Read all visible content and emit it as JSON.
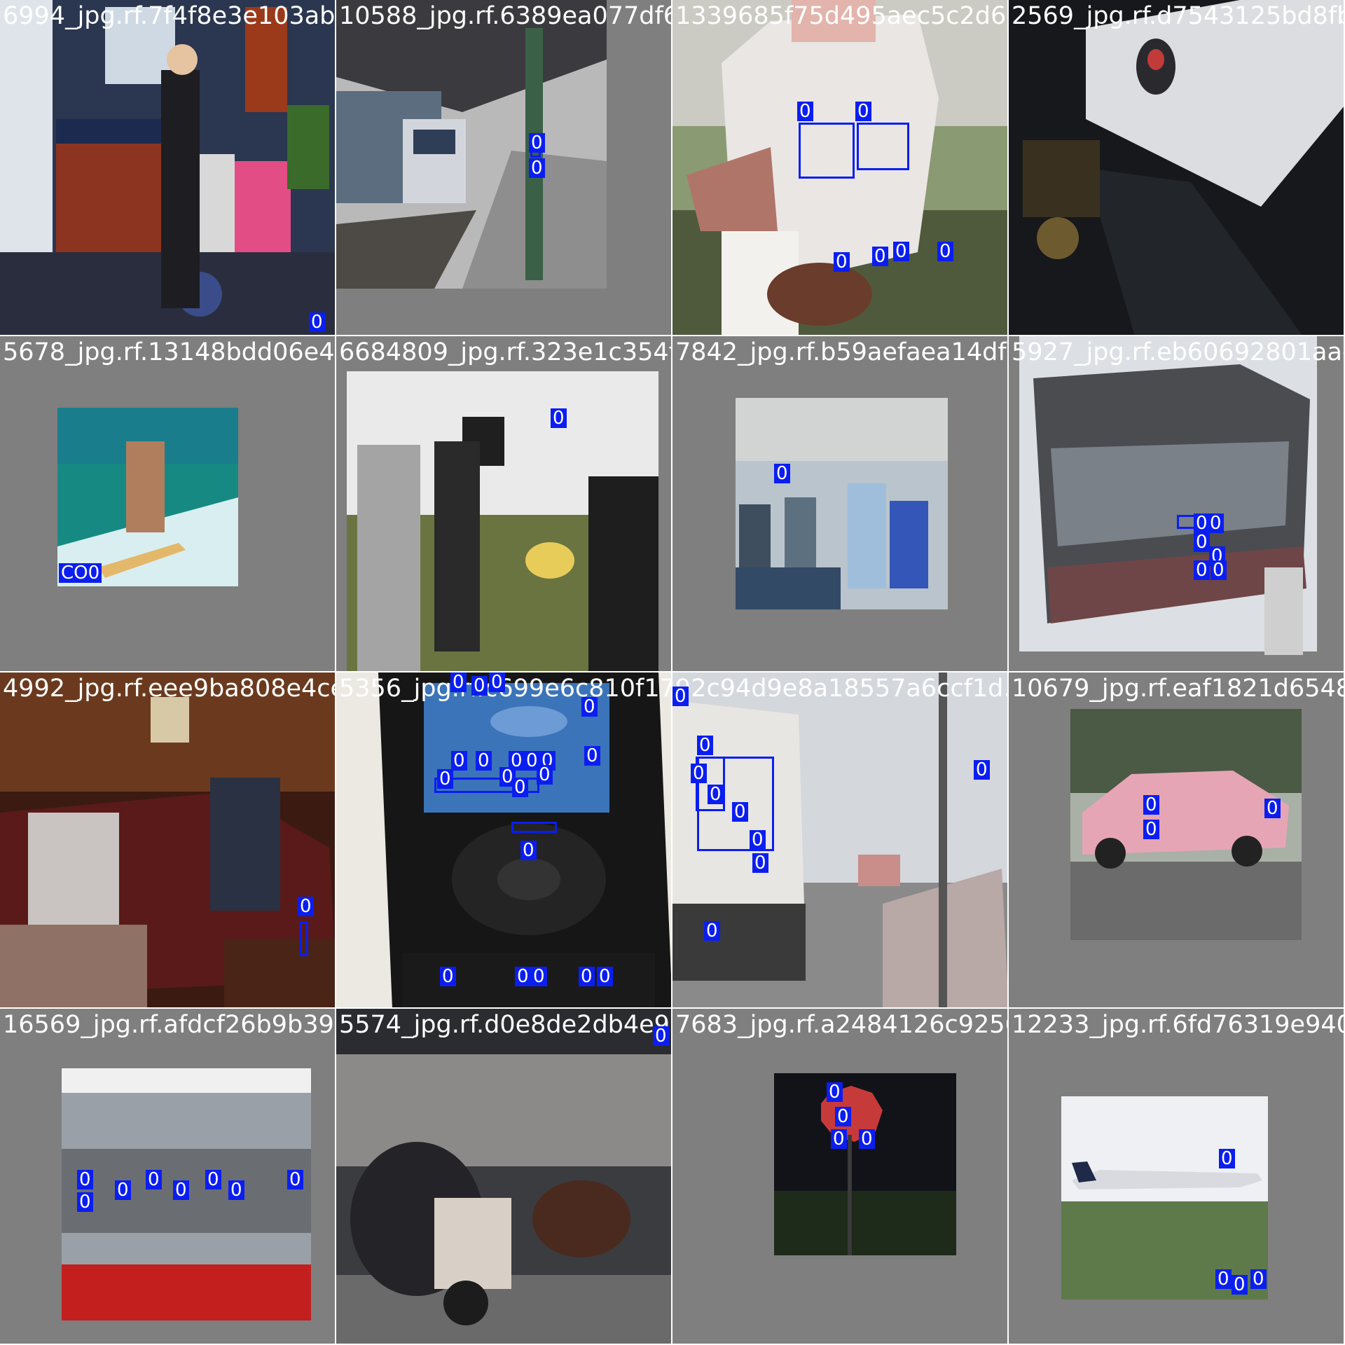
{
  "mosaic": {
    "label_color": "#0b1ef0",
    "tiles": [
      {
        "filename": "6994_jpg.rf.7f4f8e3e103ab8f06588df63...",
        "scene": "kitchen with woman",
        "labels": [
          "0"
        ]
      },
      {
        "filename": "10588_jpg.rf.6389ea077df69098234b3...",
        "scene": "train station platform",
        "labels": [
          "0",
          "0"
        ]
      },
      {
        "filename": "1339685f75d495aec5c2d6258d96ef76...",
        "scene": "baseball player",
        "labels": [
          "0",
          "0",
          "0",
          "0",
          "0",
          "0"
        ]
      },
      {
        "filename": "2569_jpg.rf.d7543125bd8fbb37...",
        "scene": "desk with keyboard and mouse",
        "labels": []
      },
      {
        "filename": "5678_jpg.rf.13148bdd06e46d064800f5288af...",
        "scene": "surfer on wave",
        "labels": [
          "CO0"
        ]
      },
      {
        "filename": "6684809_jpg.rf.323e1c354fa4b8da...",
        "scene": "men playing frisbee",
        "labels": [
          "0"
        ]
      },
      {
        "filename": "7842_jpg.rf.b59aefaea14df0bf30...",
        "scene": "office party",
        "labels": [
          "0"
        ]
      },
      {
        "filename": "5927_jpg.rf.eb60692801aad48...",
        "scene": "tour bus",
        "labels": [
          "0",
          "0",
          "0",
          "0",
          "0",
          "0"
        ]
      },
      {
        "filename": "4992_jpg.rf.eee9ba808e4ce...",
        "scene": "living room with people on couch",
        "labels": [
          "0"
        ]
      },
      {
        "filename": "5356_jpg.rf.c699e6c810f17ab58...",
        "scene": "cell phone close-up",
        "labels": [
          "0",
          "0",
          "0",
          "0",
          "0",
          "0",
          "0",
          "0",
          "0",
          "0",
          "0",
          "0",
          "0",
          "0",
          "0",
          "0",
          "0",
          "0",
          "0",
          "0"
        ]
      },
      {
        "filename": "92c94d9e8a18557a6ccf1d...",
        "scene": "truck in traffic",
        "labels": [
          "0",
          "0",
          "0",
          "0",
          "0",
          "0",
          "0",
          "0",
          "0"
        ]
      },
      {
        "filename": "10679_jpg.rf.eaf1821d65480b3...",
        "scene": "pink pickup truck",
        "labels": [
          "0",
          "0",
          "0"
        ]
      },
      {
        "filename": "16569_jpg.rf.afdcf26b9b397...",
        "scene": "bus window with street signs",
        "labels": [
          "0",
          "0",
          "0",
          "0",
          "0",
          "0",
          "0",
          "0"
        ]
      },
      {
        "filename": "5574_jpg.rf.d0e8de2db4e917...",
        "scene": "horse cart street",
        "labels": [
          "0"
        ]
      },
      {
        "filename": "7683_jpg.rf.a2484126c9256...",
        "scene": "stop sign at night",
        "labels": [
          "0",
          "0",
          "0",
          "0"
        ]
      },
      {
        "filename": "12233_jpg.rf.6fd76319e94060",
        "scene": "airplane on runway",
        "labels": [
          "0",
          "0",
          "0",
          "0"
        ]
      }
    ]
  }
}
